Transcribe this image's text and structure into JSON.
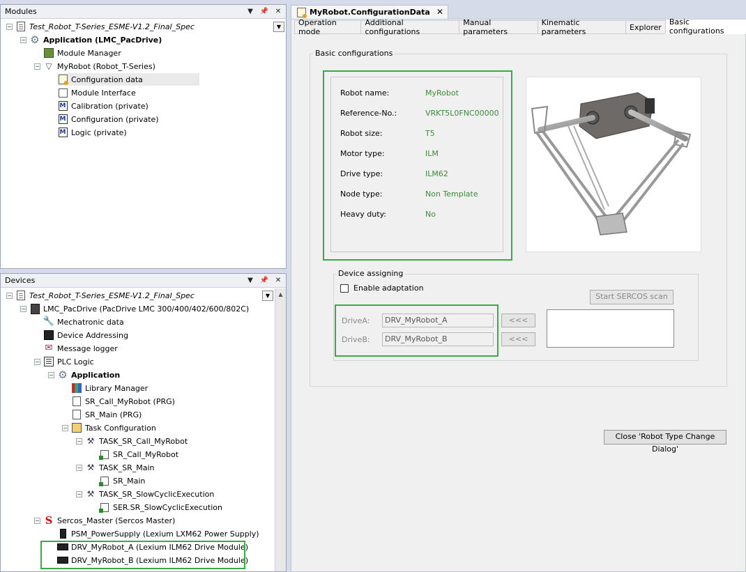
{
  "modules_panel": {
    "title": "Modules",
    "tree": [
      {
        "label": "Test_Robot_T-Series_ESME-V1.2_Final_Spec",
        "icon": "project-icon",
        "style": "italic"
      },
      {
        "label": "Application (LMC_PacDrive)",
        "icon": "gear-icon",
        "style": "bold"
      },
      {
        "label": "Module Manager",
        "icon": "module-manager-icon"
      },
      {
        "label": "MyRobot (Robot_T-Series)",
        "icon": "robot-icon"
      },
      {
        "label": "Configuration data",
        "icon": "config-data-icon"
      },
      {
        "label": "Module Interface",
        "icon": "module-interface-icon"
      },
      {
        "label": "Calibration (private)",
        "icon": "m-block-icon"
      },
      {
        "label": "Configuration (private)",
        "icon": "m-block-icon"
      },
      {
        "label": "Logic (private)",
        "icon": "m-block-icon"
      }
    ]
  },
  "devices_panel": {
    "title": "Devices",
    "tree": [
      {
        "label": "Test_Robot_T-Series_ESME-V1.2_Final_Spec",
        "icon": "project-icon",
        "style": "italic"
      },
      {
        "label": "LMC_PacDrive (PacDrive LMC 300/400/402/600/802C)",
        "icon": "controller-icon"
      },
      {
        "label": "Mechatronic data",
        "icon": "wrench-icon"
      },
      {
        "label": "Device Addressing",
        "icon": "device-addressing-icon"
      },
      {
        "label": "Message logger",
        "icon": "message-logger-icon"
      },
      {
        "label": "PLC Logic",
        "icon": "plc-logic-icon"
      },
      {
        "label": "Application",
        "icon": "gear-icon",
        "style": "bold"
      },
      {
        "label": "Library Manager",
        "icon": "library-icon"
      },
      {
        "label": "SR_Call_MyRobot (PRG)",
        "icon": "program-icon"
      },
      {
        "label": "SR_Main (PRG)",
        "icon": "program-icon"
      },
      {
        "label": "Task Configuration",
        "icon": "task-config-icon"
      },
      {
        "label": "TASK_SR_Call_MyRobot",
        "icon": "task-icon"
      },
      {
        "label": "SR_Call_MyRobot",
        "icon": "program-call-icon"
      },
      {
        "label": "TASK_SR_Main",
        "icon": "task-icon"
      },
      {
        "label": "SR_Main",
        "icon": "program-call-icon"
      },
      {
        "label": "TASK_SR_SlowCyclicExecution",
        "icon": "task-icon"
      },
      {
        "label": "SER.SR_SlowCyclicExecution",
        "icon": "program-call-icon"
      },
      {
        "label": "Sercos_Master (Sercos Master)",
        "icon": "sercos-icon"
      },
      {
        "label": "PSM_PowerSupply (Lexium LXM62 Power Supply)",
        "icon": "power-supply-icon"
      },
      {
        "label": "DRV_MyRobot_A (Lexium ILM62 Drive Module)",
        "icon": "drive-icon"
      },
      {
        "label": "DRV_MyRobot_B (Lexium ILM62 Drive Module)",
        "icon": "drive-icon"
      }
    ]
  },
  "editor": {
    "doc_tab": "MyRobot.ConfigurationData",
    "tabs": [
      "Operation mode",
      "Additional configurations",
      "Manual parameters",
      "Kinematic parameters",
      "Explorer",
      "Basic configurations"
    ],
    "active_tab": "Basic configurations",
    "group_title": "Basic configurations",
    "fields": [
      {
        "label": "Robot name:",
        "value": "MyRobot"
      },
      {
        "label": "Reference-No.:",
        "value": "VRKT5L0FNC00000"
      },
      {
        "label": "Robot size:",
        "value": "T5"
      },
      {
        "label": "Motor type:",
        "value": "ILM"
      },
      {
        "label": "Drive type:",
        "value": "ILM62"
      },
      {
        "label": "Node type:",
        "value": "Non Template"
      },
      {
        "label": "Heavy duty:",
        "value": "No"
      }
    ],
    "device_assigning": {
      "title": "Device assigning",
      "enable_adaptation": "Enable adaptation",
      "start_scan": "Start SERCOS scan",
      "drive_a_label": "DriveA:",
      "drive_a_value": "DRV_MyRobot_A",
      "drive_b_label": "DriveB:",
      "drive_b_value": "DRV_MyRobot_B",
      "assign_button": "<<<"
    },
    "close_button": "Close 'Robot Type Change Dialog'"
  },
  "colors": {
    "highlight_box": "#39a946",
    "value_text": "#3a8a3a"
  }
}
